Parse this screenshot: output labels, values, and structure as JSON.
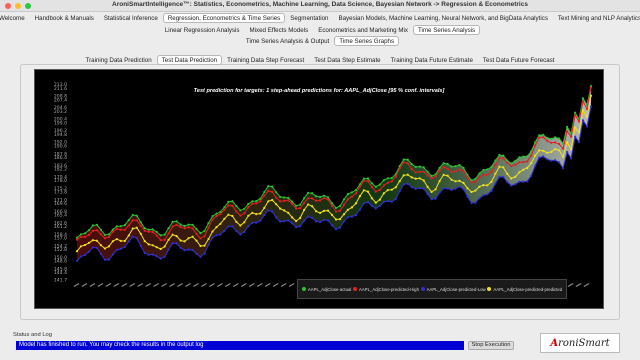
{
  "app": {
    "title": "AroniSmartIntelligence™: Statistics, Econometrics, Machine Learning, Data Science, Bayesian Network -> Regression & Econometrics"
  },
  "main_tabs": [
    "Welcome",
    "Handbook & Manuals",
    "Statistical Inference",
    "Regression, Econometrics & Time Series",
    "Segmentation",
    "Bayesian Models, Machine Learning, Neural Network, and BigData Analytics",
    "Text Mining and NLP Analytics"
  ],
  "sub_tabs": [
    "Linear Regression Analysis",
    "Mixed Effects Models",
    "Econometrics and Marketing Mix",
    "Time Series Analysis"
  ],
  "sub_sub_tabs": [
    "Time Series Analysis & Output",
    "Time Series Graphs"
  ],
  "graph_tabs": [
    "Training Data Prediction",
    "Test Data Prediction",
    "Training Data Step Forecast",
    "Test  Data Step Estimate",
    "Training Data Future Estimate",
    "Test  Data Future Forecast"
  ],
  "active": {
    "main": 3,
    "sub": 3,
    "subsub": 1,
    "graph": 1
  },
  "chart_data": {
    "type": "line",
    "title": "Test prediction for targets: 1  step-ahead predictions for: AAPL_AdjClose [95 % conf. intervals]",
    "ylim": [
      141.7,
      214.0
    ],
    "yticks": [
      213.0,
      211.6,
      208.8,
      207.4,
      204.6,
      203.2,
      200.4,
      199.0,
      196.2,
      194.8,
      192.0,
      190.6,
      187.8,
      186.4,
      183.6,
      182.2,
      179.4,
      178.0,
      175.2,
      173.8,
      171.0,
      169.6,
      166.8,
      165.4,
      162.6,
      161.2,
      158.4,
      157.0,
      154.2,
      152.8,
      150.0,
      148.6,
      145.8,
      144.4,
      141.7
    ],
    "n_points": 130,
    "series": [
      {
        "name": "AAPL_AdjClose-actual",
        "color": "#2ec02e"
      },
      {
        "name": "AAPL_AdjClose-predicted-High",
        "color": "#e02020"
      },
      {
        "name": "AAPL_AdjClose-predicted-Low",
        "color": "#3030d0"
      },
      {
        "name": "AAPL_AdjClose-predicted-predicted",
        "color": "#f0e020"
      }
    ],
    "legend_position": "bottom-right",
    "grid": false
  },
  "status": {
    "label": "Status and Log",
    "message": "Model has finished to run. You may check the results in the output log",
    "stop_button": "Stop Execution"
  },
  "logo_text": "AroniSmart"
}
